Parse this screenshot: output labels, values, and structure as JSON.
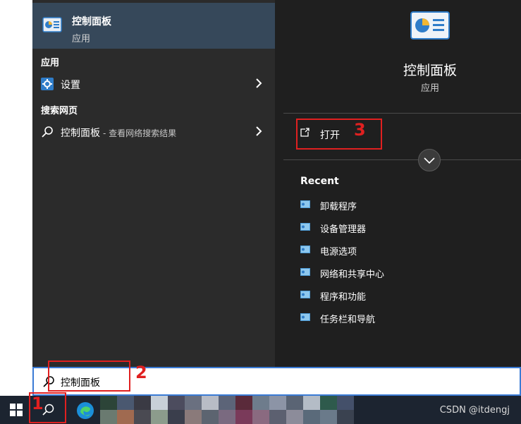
{
  "top_result": {
    "name": "控制面板",
    "type": "应用"
  },
  "sections": {
    "apps_label": "应用",
    "web_label": "搜索网页"
  },
  "apps": [
    {
      "label": "设置"
    }
  ],
  "web": {
    "label": "控制面板",
    "sublabel": "- 查看网络搜索结果"
  },
  "details": {
    "title": "控制面板",
    "type": "应用",
    "open_label": "打开",
    "recent_title": "Recent",
    "recent": [
      "卸载程序",
      "设备管理器",
      "电源选项",
      "网络和共享中心",
      "程序和功能",
      "任务栏和导航"
    ]
  },
  "search": {
    "value": "控制面板"
  },
  "annotations": [
    "1",
    "2",
    "3"
  ],
  "watermark": "CSDN @itdengj",
  "colors": {
    "left_panel": "#2b2b2b",
    "top_result_bg": "#36485a",
    "right_panel": "#1f1f1f",
    "annotation_red": "#e02020",
    "search_border": "#3a7bd5",
    "taskbar": "#1c2430"
  },
  "icons": [
    "control-panel-icon",
    "gear-icon",
    "search-icon",
    "chevron-right-icon",
    "open-external-icon",
    "chevron-down-icon",
    "windows-start-icon",
    "edge-icon"
  ]
}
